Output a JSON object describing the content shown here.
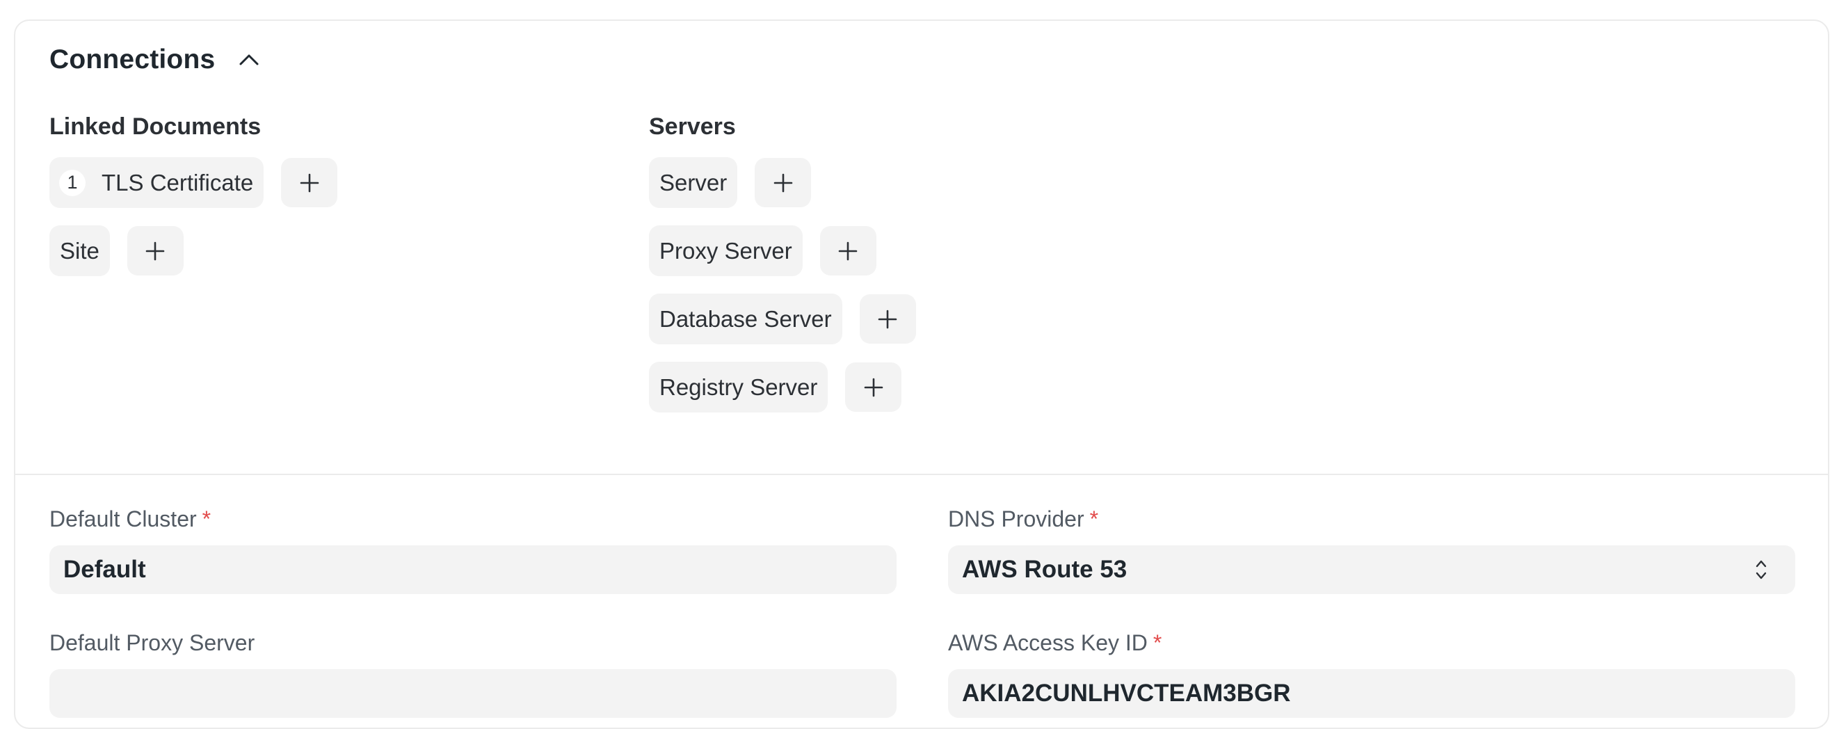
{
  "connections": {
    "title": "Connections",
    "linked_documents": {
      "title": "Linked Documents",
      "items": [
        {
          "label": "TLS Certificate",
          "count": "1"
        },
        {
          "label": "Site"
        }
      ]
    },
    "servers": {
      "title": "Servers",
      "items": [
        {
          "label": "Server"
        },
        {
          "label": "Proxy Server"
        },
        {
          "label": "Database Server"
        },
        {
          "label": "Registry Server"
        }
      ]
    }
  },
  "form": {
    "default_cluster": {
      "label": "Default Cluster",
      "required": "*",
      "value": "Default"
    },
    "dns_provider": {
      "label": "DNS Provider",
      "required": "*",
      "value": "AWS Route 53"
    },
    "default_proxy_server": {
      "label": "Default Proxy Server",
      "value": ""
    },
    "aws_access_key_id": {
      "label": "AWS Access Key ID",
      "required": "*",
      "value": "AKIA2CUNLHVCTEAM3BGR"
    }
  },
  "icons": {
    "collapse": "chevron-up-icon",
    "add": "plus-icon",
    "select": "select-arrows-icon"
  },
  "colors": {
    "required": "#e24c4c",
    "pill_bg": "#f3f3f3",
    "border": "#ebebeb"
  }
}
